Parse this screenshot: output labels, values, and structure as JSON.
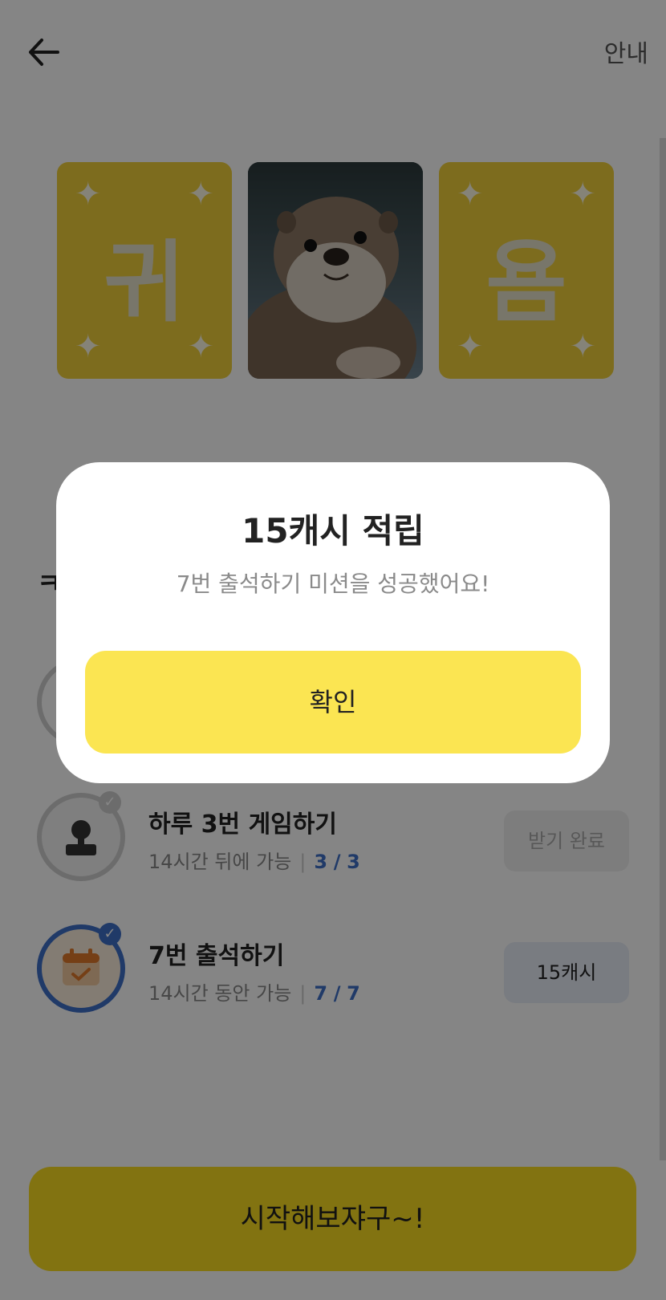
{
  "header": {
    "guide_label": "안내"
  },
  "cards": [
    {
      "letter": "귀"
    },
    {
      "image": "otter-photo"
    },
    {
      "letter": "욤"
    }
  ],
  "section_title_fragment": "ㅋ",
  "missions": [
    {
      "title": "하루 3번 게임하기",
      "availability": "14시간 뒤에 가능",
      "progress_current": "3",
      "progress_sep": "/",
      "progress_total": "3",
      "action_label": "받기 완료",
      "completed": true
    },
    {
      "title": "7번 출석하기",
      "availability": "14시간 동안 가능",
      "progress_current": "7",
      "progress_sep": "/",
      "progress_total": "7",
      "action_label": "15캐시",
      "completed": false
    }
  ],
  "cta_label": "시작해보쟈구~!",
  "modal": {
    "title": "15캐시 적립",
    "message": "7번 출석하기 미션을 성공했어요!",
    "confirm_label": "확인"
  },
  "colors": {
    "accent_yellow": "#f9dc22",
    "modal_button": "#fbe552",
    "accent_blue": "#3e6fc7"
  }
}
